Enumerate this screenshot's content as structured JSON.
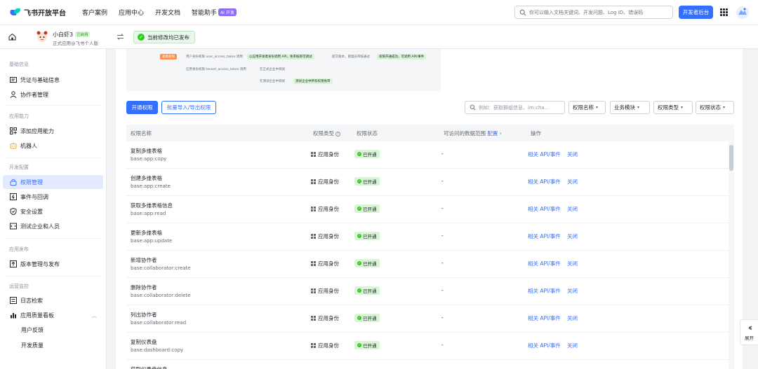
{
  "topnav": {
    "brand": "飞书开放平台",
    "items": [
      "客户案例",
      "应用中心",
      "开发文档",
      "智能助手"
    ],
    "ai_badge": "AI 开发",
    "search_placeholder": "你可以输入文档关键词、开发问题、Log ID、错误码",
    "dev_button": "开发者后台"
  },
  "appbar": {
    "app_name": "小白虾3",
    "app_tag": "已启用",
    "app_sub": "正式应用@飞书个人版",
    "publish_note": "当前修改均已发布"
  },
  "sidebar": {
    "sections": {
      "basic": "基础信息",
      "ability": "应用能力",
      "dev": "开发配置",
      "release": "应用发布",
      "ops": "运营监控"
    },
    "items": {
      "credentials": "凭证与基础信息",
      "collaborators": "协作者管理",
      "add_ability": "添加应用能力",
      "bot": "机器人",
      "permissions": "权限管理",
      "events": "事件与回调",
      "security": "安全设置",
      "test_company": "测试企业和人员",
      "versions": "版本管理与发布",
      "logs": "日志检索",
      "quality": "应用质量看板",
      "feedback": "用户反馈",
      "dev_quality": "开发质量"
    }
  },
  "flow": {
    "tag_orange": "查看权限",
    "l1": "用户身份权限 user_access_token 调用",
    "g1": "以应用开发者身份调用 API，免审核即可调试",
    "l2": "提交版本，管理员审核通过",
    "g2": "权限开通成功，可调用 API/事件",
    "l3": "应用身份权限 tenant_access_token 调用",
    "l4": "在正式企业中调试",
    "l5": "在测试企业中调试",
    "g3": "测试企业中所有权限免审"
  },
  "toolbar": {
    "open_perm": "开通权限",
    "batch": "批量导入/导出权限",
    "search_placeholder": "例如：获取群组信息、im:cha...",
    "dropdowns": [
      "权限名称",
      "业务模块",
      "权限类型",
      "权限状态"
    ]
  },
  "table": {
    "headers": {
      "name": "权限名称",
      "type": "权限类型",
      "status": "权限状态",
      "range": "可访问的数据范围",
      "range_link": "配置",
      "ops": "操作"
    },
    "rows": [
      {
        "name": "复制多维表格",
        "code": "base:app:copy",
        "type": "应用身份",
        "status": "已开通",
        "range": "-",
        "op1": "相关 API/事件",
        "op2": "关闭"
      },
      {
        "name": "创建多维表格",
        "code": "base:app:create",
        "type": "应用身份",
        "status": "已开通",
        "range": "-",
        "op1": "相关 API/事件",
        "op2": "关闭"
      },
      {
        "name": "获取多维表格信息",
        "code": "base:app:read",
        "type": "应用身份",
        "status": "已开通",
        "range": "-",
        "op1": "相关 API/事件",
        "op2": "关闭"
      },
      {
        "name": "更新多维表格",
        "code": "base:app:update",
        "type": "应用身份",
        "status": "已开通",
        "range": "-",
        "op1": "相关 API/事件",
        "op2": "关闭"
      },
      {
        "name": "新增协作者",
        "code": "base:collaborator:create",
        "type": "应用身份",
        "status": "已开通",
        "range": "-",
        "op1": "相关 API/事件",
        "op2": "关闭"
      },
      {
        "name": "删除协作者",
        "code": "base:collaborator:delete",
        "type": "应用身份",
        "status": "已开通",
        "range": "-",
        "op1": "相关 API/事件",
        "op2": "关闭"
      },
      {
        "name": "列出协作者",
        "code": "base:collaborator:read",
        "type": "应用身份",
        "status": "已开通",
        "range": "-",
        "op1": "相关 API/事件",
        "op2": "关闭"
      },
      {
        "name": "复制仪表盘",
        "code": "base:dashboard:copy",
        "type": "应用身份",
        "status": "已开通",
        "range": "-",
        "op1": "相关 API/事件",
        "op2": "关闭"
      },
      {
        "name": "获取仪表盘信息",
        "code": "",
        "type": "",
        "status": "",
        "range": "",
        "op1": "",
        "op2": ""
      }
    ]
  },
  "expand_label": "展开",
  "colors": {
    "brand": "#3370ff",
    "success": "#34c724",
    "success_bg": "#d9f5d6"
  }
}
